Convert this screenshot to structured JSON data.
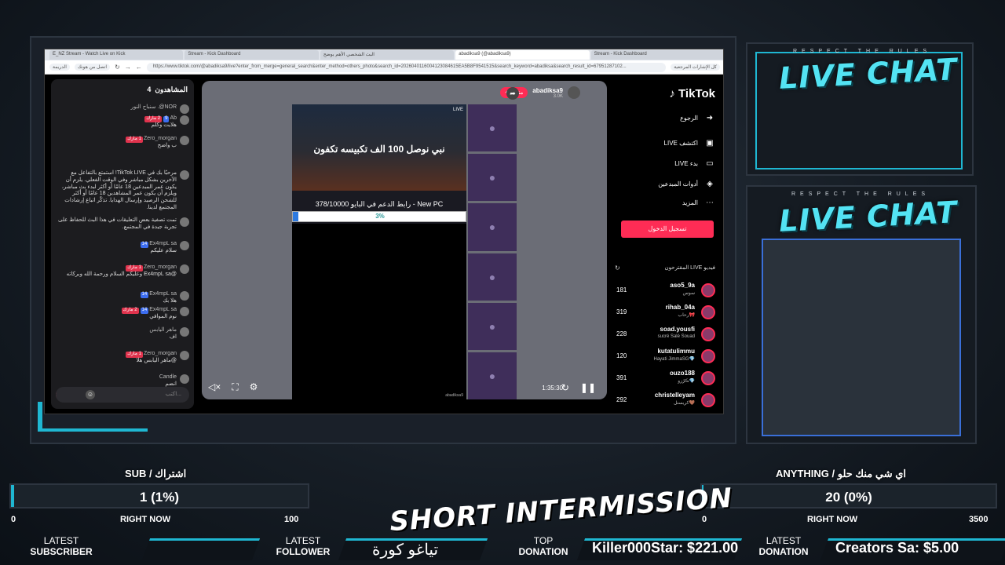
{
  "browser": {
    "tabs": [
      "E_NZ Stream - Watch Live on Kick",
      "Stream - Kick Dashboard",
      "البث الشخصي الأهم يوضح",
      "abadiksa9 (@abadiksa9)",
      "Stream - Kick Dashboard"
    ],
    "url": "https://www.tiktok.com/@abadiksa9/live?enter_from_merge=general_search&enter_method=others_photo&search_id=2026040116004123084615EA5B8F9541515&search_keyword=abadiksa&search_result_id=67951287102...",
    "bookmark_left": "الدريمة",
    "bookmark_right": "اتصل من هونك",
    "bookmark_folder": "كل الإشارات المرجعية"
  },
  "left_chat": {
    "header": "المشاهدون",
    "viewer_count": "4",
    "messages": [
      {
        "user": "NOR@. سنباح النور",
        "badges": [],
        "text": ""
      },
      {
        "user": "Ab",
        "badges": [
          "9",
          "2 مارك"
        ],
        "text": "هلايت وكلم"
      },
      {
        "user": "Zero_morgan",
        "badges": [
          "1 مارك"
        ],
        "text": "ب واضح"
      },
      {
        "user": "",
        "badges": [],
        "text": "مرحبًا بك في TikTok LIVE! استمتع بالتفاعل مع الآخرين بشكل مباشر وفي الوقت الفعلي. يلزم أن يكون عمر المبدعين 18 عامًا أو أكثر لبدء بث مباشر، ويلزم أن يكون عمر المشاهدين 18 عامًا أو أكثر للشحن الرصيد وإرسال الهدايا. تذكّر اتباع إرشادات المجتمع لدينا."
      },
      {
        "user": "",
        "badges": [],
        "text": "تمت تصفية بعض التعليقات في هذا البث للحفاظ على تجربة جيدة في المجتمع."
      },
      {
        "user": "Ex4mpL sa",
        "badges": [
          "14"
        ],
        "text": "سلام عليكم"
      },
      {
        "user": "Zero_morgan",
        "badges": [
          "1 مارك"
        ],
        "text": "@Ex4mpL sa وعليكم السلام ورحمة الله وبركاته"
      },
      {
        "user": "Ex4mpL sa",
        "badges": [
          "14"
        ],
        "text": "هلا بك"
      },
      {
        "user": "Ex4mpL sa",
        "badges": [
          "14",
          "2 مارك"
        ],
        "text": "نوم الموافي"
      },
      {
        "user": "ماهر اليابس",
        "badges": [],
        "text": "اف"
      },
      {
        "user": "Zero_morgan",
        "badges": [
          "1 مارك"
        ],
        "text": "@ماهر اليابس هلا"
      },
      {
        "user": "Candle",
        "badges": [],
        "text": "انضم"
      }
    ],
    "input_placeholder": "اكتب..."
  },
  "video": {
    "host_name": "abadiksa9",
    "host_likes": "3.0K",
    "follow_label": "+ متابعة",
    "live_badge": "LIVE",
    "overlay_title": "نبي نوصل 100 الف تكبيسه تكفون",
    "donate_text": "New PC - رابط الدعم في البايو 378/10000",
    "progress": 0.03,
    "progress_text": "3%",
    "elapsed": "1:35:30",
    "watermark": "abadiksa9"
  },
  "tiktok_side": {
    "logo": "TikTok",
    "nav": [
      {
        "label": "الرجوع",
        "icon": "back-arrow-icon",
        "glyph": "➜"
      },
      {
        "label": "LIVE اكتشف",
        "icon": "tv-icon",
        "glyph": "▣"
      },
      {
        "label": "LIVE بدء",
        "icon": "camera-icon",
        "glyph": "▭"
      },
      {
        "label": "أدوات المبدعين",
        "icon": "tools-icon",
        "glyph": "◈"
      },
      {
        "label": "المزيد",
        "icon": "more-icon",
        "glyph": "⋯"
      }
    ],
    "login": "تسجيل الدخول",
    "suggested_header": "فيديو LIVE المقترحون",
    "suggested": [
      {
        "name": "aso5_9a",
        "sub": "سوس",
        "count": "181"
      },
      {
        "name": "rihab_04a",
        "sub": "رحاب🎀",
        "count": "319"
      },
      {
        "name": "soad.yousfi",
        "sub": "sucré Salé Souad",
        "count": "228"
      },
      {
        "name": "kutatulimmu",
        "sub": "Hayati JimmaSG💎",
        "count": "120"
      },
      {
        "name": "ouzo188",
        "sub": "ڪرُزو💎",
        "count": "391"
      },
      {
        "name": "christelleyam",
        "sub": "كريستل🤎",
        "count": "292"
      }
    ]
  },
  "chat_panels": {
    "respect": "RESPECT THE RULES",
    "title": "LIVE CHAT"
  },
  "goals": {
    "sub": {
      "title": "SUB / اشتراك",
      "value": "1 (1%)",
      "min": "0",
      "max": "100",
      "now": "RIGHT NOW",
      "fraction": 0.01
    },
    "anything": {
      "title": "ANYTHING / اي شي منك حلو",
      "value": "20 (0%)",
      "min": "0",
      "max": "3500",
      "now": "RIGHT NOW",
      "fraction": 0.006
    }
  },
  "intermission": "SHORT INTERMISSION",
  "bottom": {
    "latest_sub_l1": "LATEST",
    "latest_sub_l2": "SUBSCRIBER",
    "latest_sub_value": "",
    "latest_follow_l1": "LATEST",
    "latest_follow_l2": "FOLLOWER",
    "latest_follow_value": "تياغو كورة",
    "top_don_l1": "TOP",
    "top_don_l2": "DONATION",
    "top_don_value": "Killer000Star: $221.00",
    "latest_don_l1": "LATEST",
    "latest_don_l2": "DONATION",
    "latest_don_value": "Creators Sa: $5.00"
  },
  "colors": {
    "accent": "#1fb7d2",
    "tiktok_red": "#fe2c55",
    "chat_title": "#53e3f3"
  }
}
